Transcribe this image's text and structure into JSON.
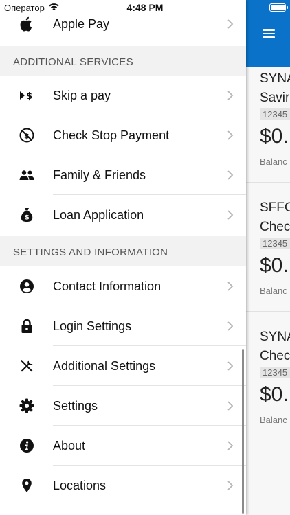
{
  "status_bar": {
    "carrier": "Оператор",
    "time": "4:48 PM"
  },
  "colors": {
    "accent": "#0a73c9",
    "section_bg": "#f2f2f2"
  },
  "menu": {
    "top_items": [
      {
        "label": "Apple Pay",
        "icon": "apple-icon"
      }
    ],
    "sections": [
      {
        "title": "ADDITIONAL SERVICES",
        "items": [
          {
            "label": "Skip a pay",
            "icon": "skip-pay-icon"
          },
          {
            "label": "Check Stop Payment",
            "icon": "stop-check-icon"
          },
          {
            "label": "Family & Friends",
            "icon": "people-icon"
          },
          {
            "label": "Loan Application",
            "icon": "money-bag-icon"
          }
        ]
      },
      {
        "title": "SETTINGS AND INFORMATION",
        "items": [
          {
            "label": "Contact Information",
            "icon": "user-circle-icon"
          },
          {
            "label": "Login Settings",
            "icon": "lock-icon"
          },
          {
            "label": "Additional Settings",
            "icon": "tools-icon"
          },
          {
            "label": "Settings",
            "icon": "gear-icon"
          },
          {
            "label": "About",
            "icon": "info-icon"
          },
          {
            "label": "Locations",
            "icon": "location-pin-icon"
          }
        ]
      }
    ]
  },
  "accounts": [
    {
      "name": "SYNA",
      "type": "Savir",
      "number": "12345",
      "amount": "$0.",
      "balance_label": "Balanc"
    },
    {
      "name": "SFFC",
      "type": "Chec",
      "number": "12345",
      "amount": "$0.",
      "balance_label": "Balanc"
    },
    {
      "name": "SYNA",
      "type": "Chec",
      "number": "12345",
      "amount": "$0.",
      "balance_label": "Balanc"
    }
  ]
}
